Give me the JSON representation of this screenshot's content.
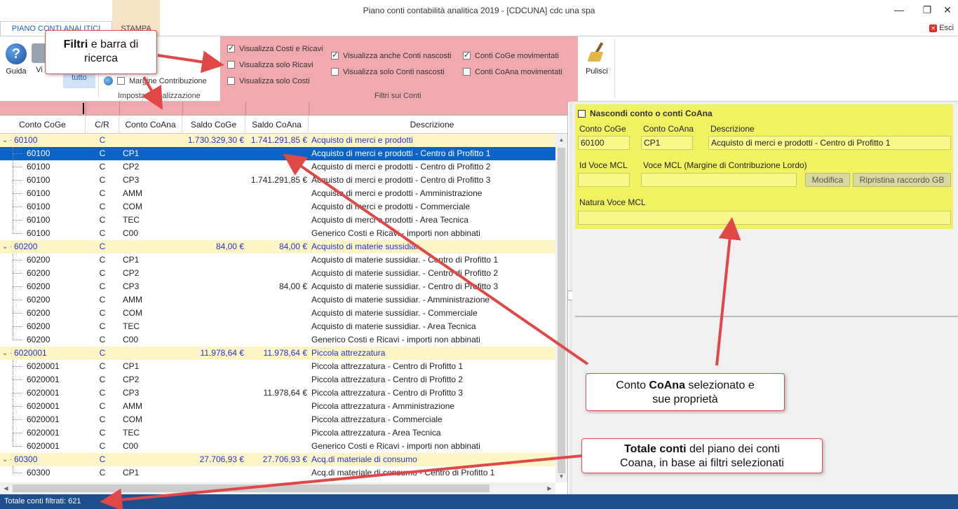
{
  "window": {
    "title": "Piano conti contabilità analitica 2019 - [CDCUNA] cdc una spa",
    "minimize": "—",
    "restore": "❐",
    "close": "✕"
  },
  "tabs": {
    "active": "PIANO CONTI ANALITICI",
    "stampa": "STAMPA",
    "esci": "Esci"
  },
  "ribbon": {
    "guida": "Guida",
    "vista": "Vi",
    "tutto_top": "",
    "tutto": "tutto",
    "margine": "Margine Contribuzione",
    "imposta_label": "Imposta Visualizzazione",
    "filters": {
      "costi_ricavi": "Visualizza Costi e Ricavi",
      "solo_ricavi": "Visualizza solo Ricavi",
      "solo_costi": "Visualizza solo Costi",
      "anche_nascosti": "Visualizza anche Conti nascosti",
      "solo_nascosti": "Visualizza solo Conti nascosti",
      "coge_mov": "Conti CoGe movimentati",
      "coana_mov": "Conti CoAna movimentati",
      "label": "Filtri sui Conti"
    },
    "pulisci": "Pulisci"
  },
  "grid": {
    "headers": [
      "Conto CoGe",
      "C/R",
      "Conto CoAna",
      "Saldo CoGe",
      "Saldo CoAna",
      "Descrizione"
    ],
    "rows": [
      {
        "type": "group",
        "coge": "60100",
        "cr": "C",
        "coana": "",
        "saldo_coge": "1.730.329,30 €",
        "saldo_coana": "1.741.291,85 €",
        "desc": "Acquisto di merci e prodotti"
      },
      {
        "type": "child",
        "selected": true,
        "coge": "60100",
        "cr": "C",
        "coana": "CP1",
        "saldo_coge": "",
        "saldo_coana": "",
        "desc": "Acquisto di merci e prodotti - Centro di Profitto 1"
      },
      {
        "type": "child",
        "coge": "60100",
        "cr": "C",
        "coana": "CP2",
        "saldo_coge": "",
        "saldo_coana": "",
        "desc": "Acquisto di merci e prodotti - Centro di Profitto 2"
      },
      {
        "type": "child",
        "coge": "60100",
        "cr": "C",
        "coana": "CP3",
        "saldo_coge": "",
        "saldo_coana": "1.741.291,85 €",
        "desc": "Acquisto di merci e prodotti - Centro di Profitto 3"
      },
      {
        "type": "child",
        "coge": "60100",
        "cr": "C",
        "coana": "AMM",
        "saldo_coge": "",
        "saldo_coana": "",
        "desc": "Acquisto di merci e prodotti - Amministrazione"
      },
      {
        "type": "child",
        "coge": "60100",
        "cr": "C",
        "coana": "COM",
        "saldo_coge": "",
        "saldo_coana": "",
        "desc": "Acquisto di merci e prodotti - Commerciale"
      },
      {
        "type": "child",
        "coge": "60100",
        "cr": "C",
        "coana": "TEC",
        "saldo_coge": "",
        "saldo_coana": "",
        "desc": "Acquisto di merci e prodotti - Area Tecnica"
      },
      {
        "type": "child",
        "coge": "60100",
        "cr": "C",
        "coana": "C00",
        "saldo_coge": "",
        "saldo_coana": "",
        "desc": "Generico Costi e Ricavi - importi non abbinati"
      },
      {
        "type": "group",
        "coge": "60200",
        "cr": "C",
        "coana": "",
        "saldo_coge": "84,00 €",
        "saldo_coana": "84,00 €",
        "desc": "Acquisto di materie sussidiar."
      },
      {
        "type": "child",
        "coge": "60200",
        "cr": "C",
        "coana": "CP1",
        "saldo_coge": "",
        "saldo_coana": "",
        "desc": "Acquisto di materie sussidiar. - Centro di Profitto 1"
      },
      {
        "type": "child",
        "coge": "60200",
        "cr": "C",
        "coana": "CP2",
        "saldo_coge": "",
        "saldo_coana": "",
        "desc": "Acquisto di materie sussidiar. - Centro di Profitto 2"
      },
      {
        "type": "child",
        "coge": "60200",
        "cr": "C",
        "coana": "CP3",
        "saldo_coge": "",
        "saldo_coana": "84,00 €",
        "desc": "Acquisto di materie sussidiar. - Centro di Profitto 3"
      },
      {
        "type": "child",
        "coge": "60200",
        "cr": "C",
        "coana": "AMM",
        "saldo_coge": "",
        "saldo_coana": "",
        "desc": "Acquisto di materie sussidiar. - Amministrazione"
      },
      {
        "type": "child",
        "coge": "60200",
        "cr": "C",
        "coana": "COM",
        "saldo_coge": "",
        "saldo_coana": "",
        "desc": "Acquisto di materie sussidiar. - Commerciale"
      },
      {
        "type": "child",
        "coge": "60200",
        "cr": "C",
        "coana": "TEC",
        "saldo_coge": "",
        "saldo_coana": "",
        "desc": "Acquisto di materie sussidiar. - Area Tecnica"
      },
      {
        "type": "child",
        "coge": "60200",
        "cr": "C",
        "coana": "C00",
        "saldo_coge": "",
        "saldo_coana": "",
        "desc": "Generico Costi e Ricavi - importi non abbinati"
      },
      {
        "type": "group",
        "coge": "6020001",
        "cr": "C",
        "coana": "",
        "saldo_coge": "11.978,64 €",
        "saldo_coana": "11.978,64 €",
        "desc": "Piccola attrezzatura"
      },
      {
        "type": "child",
        "coge": "6020001",
        "cr": "C",
        "coana": "CP1",
        "saldo_coge": "",
        "saldo_coana": "",
        "desc": "Piccola attrezzatura - Centro di Profitto 1"
      },
      {
        "type": "child",
        "coge": "6020001",
        "cr": "C",
        "coana": "CP2",
        "saldo_coge": "",
        "saldo_coana": "",
        "desc": "Piccola attrezzatura - Centro di Profitto 2"
      },
      {
        "type": "child",
        "coge": "6020001",
        "cr": "C",
        "coana": "CP3",
        "saldo_coge": "",
        "saldo_coana": "11.978,64 €",
        "desc": "Piccola attrezzatura - Centro di Profitto 3"
      },
      {
        "type": "child",
        "coge": "6020001",
        "cr": "C",
        "coana": "AMM",
        "saldo_coge": "",
        "saldo_coana": "",
        "desc": "Piccola attrezzatura - Amministrazione"
      },
      {
        "type": "child",
        "coge": "6020001",
        "cr": "C",
        "coana": "COM",
        "saldo_coge": "",
        "saldo_coana": "",
        "desc": "Piccola attrezzatura - Commerciale"
      },
      {
        "type": "child",
        "coge": "6020001",
        "cr": "C",
        "coana": "TEC",
        "saldo_coge": "",
        "saldo_coana": "",
        "desc": "Piccola attrezzatura - Area Tecnica"
      },
      {
        "type": "child",
        "coge": "6020001",
        "cr": "C",
        "coana": "C00",
        "saldo_coge": "",
        "saldo_coana": "",
        "desc": "Generico Costi e Ricavi - importi non abbinati"
      },
      {
        "type": "group",
        "coge": "60300",
        "cr": "C",
        "coana": "",
        "saldo_coge": "27.706,93 €",
        "saldo_coana": "27.706,93 €",
        "desc": "Acq.di materiale di consumo"
      },
      {
        "type": "child",
        "coge": "60300",
        "cr": "C",
        "coana": "CP1",
        "saldo_coge": "",
        "saldo_coana": "",
        "desc": "Acq.di materiale di consumo - Centro di Profitto 1"
      }
    ]
  },
  "detail": {
    "nascondi": "Nascondi conto o conti CoAna",
    "conto_coge_label": "Conto CoGe",
    "conto_coana_label": "Conto CoAna",
    "descrizione_label": "Descrizione",
    "conto_coge": "60100",
    "conto_coana": "CP1",
    "descrizione": "Acquisto di merci e prodotti - Centro di Profitto 1",
    "id_voce_label": "Id Voce MCL",
    "voce_label": "Voce MCL  (Margine di Contribuzione Lordo)",
    "modifica": "Modifica",
    "ripristina": "Ripristina raccordo GB",
    "natura_label": "Natura Voce MCL"
  },
  "status": {
    "text": "Totale conti filtrati: 621"
  },
  "callouts": {
    "filtri_bold": "Filtri",
    "filtri_rest": " e barra di",
    "filtri_line2": "ricerca",
    "coana_pre": "Conto ",
    "coana_bold": "CoAna",
    "coana_post": " selezionato e",
    "coana_line2": "sue proprietà",
    "totale_bold": "Totale conti",
    "totale_rest": " del piano dei conti",
    "totale_line2": "Coana, in base ai filtri selezionati"
  },
  "colors": {
    "filter_zone": "#f0a9ad",
    "selected_row": "#0a64c8",
    "group_row": "#fff6c7",
    "detail_panel": "#f2f260",
    "status_bar": "#1f4e8c",
    "arrow": "#e04848"
  }
}
